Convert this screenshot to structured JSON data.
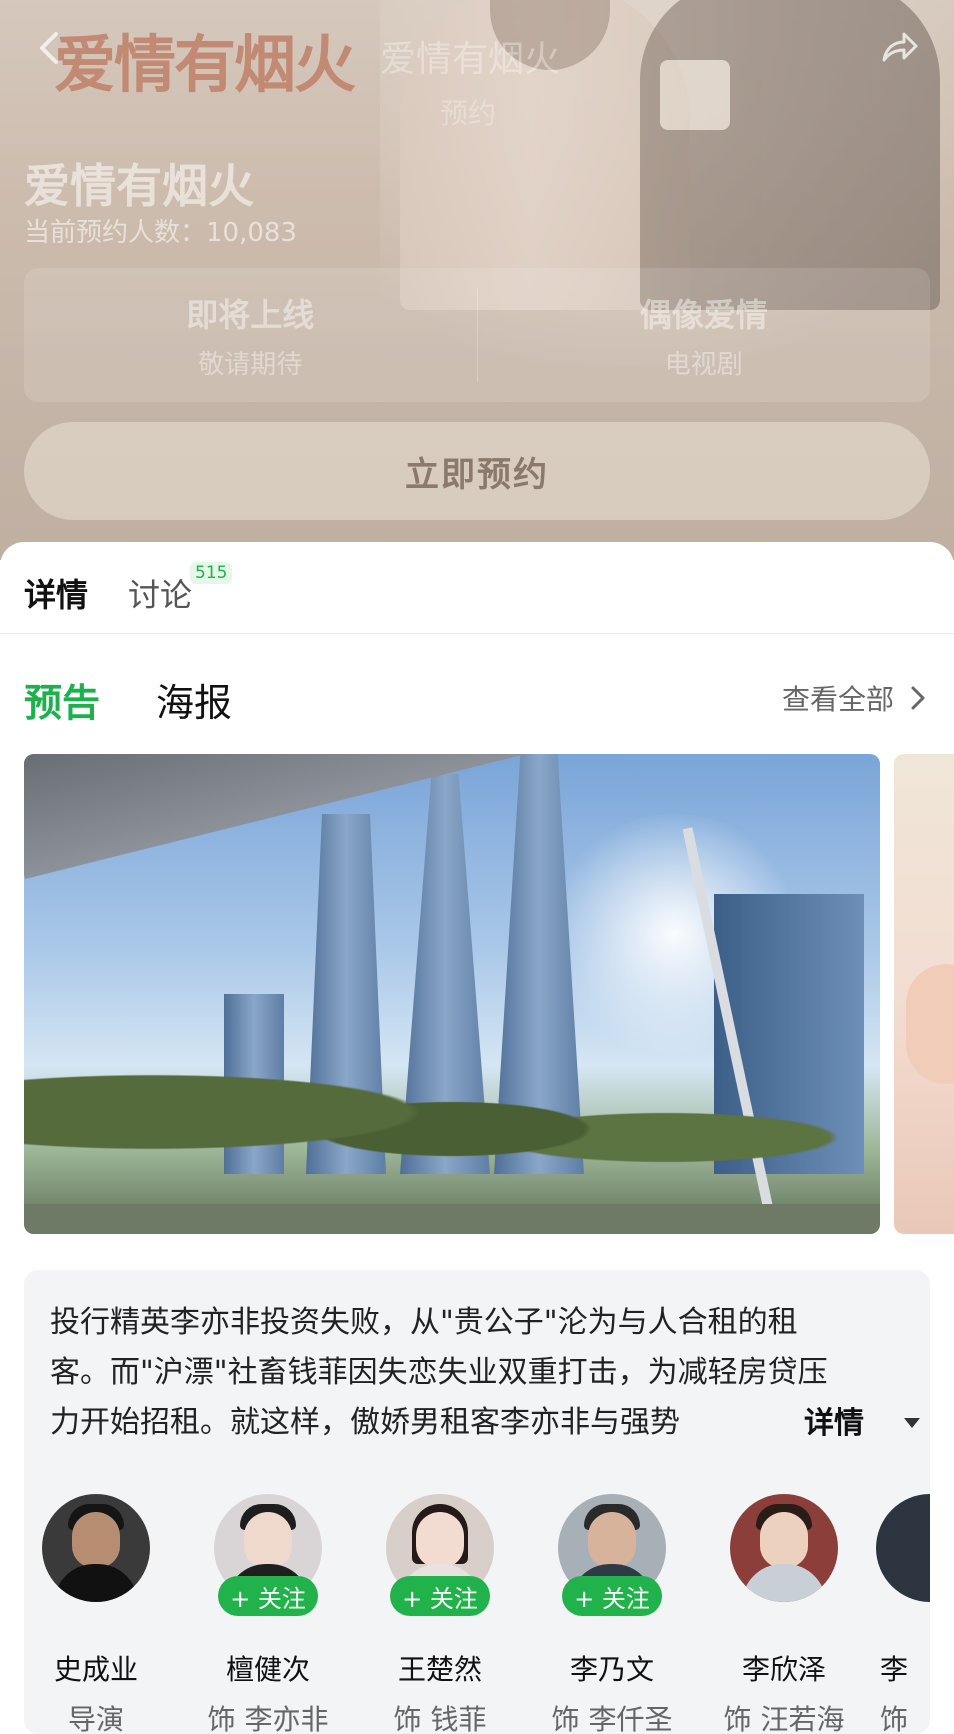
{
  "header": {
    "logo_text": "爱情有烟火",
    "ghost_title": "爱情有烟火",
    "ghost_subtitle": "预约",
    "title": "爱情有烟火",
    "reserve_count": "当前预约人数：10,083",
    "info": [
      {
        "main": "即将上线",
        "sub": "敬请期待"
      },
      {
        "main": "偶像爱情",
        "sub": "电视剧"
      }
    ],
    "reserve_button": "立即预约"
  },
  "tabs": {
    "detail": "详情",
    "discuss": "讨论",
    "discuss_badge": "515"
  },
  "media": {
    "trailer_tab": "预告",
    "poster_tab": "海报",
    "view_all": "查看全部"
  },
  "synopsis": {
    "text": "投行精英李亦非投资失败，从\"贵公子\"沦为与人合租的租客。而\"沪漂\"社畜钱菲因失恋失业双重打击，为减轻房贷压力开始招租。就这样，傲娇男租客李亦非与强势",
    "toggle": "详情"
  },
  "cast": [
    {
      "name": "史成业",
      "role": "导演",
      "follow": ""
    },
    {
      "name": "檀健次",
      "role": "饰 李亦非",
      "follow": "+ 关注"
    },
    {
      "name": "王楚然",
      "role": "饰 钱菲",
      "follow": "+ 关注"
    },
    {
      "name": "李乃文",
      "role": "饰 李仟圣",
      "follow": "+ 关注"
    },
    {
      "name": "李欣泽",
      "role": "饰 汪若海",
      "follow": ""
    },
    {
      "name": "李",
      "role": "饰",
      "follow": ""
    }
  ],
  "colors": {
    "accent_green": "#1db14e",
    "follow_green": "#22b24c",
    "logo": "#c07f68"
  },
  "icons": [
    "back-icon",
    "share-icon",
    "chevron-right-icon",
    "caret-down-icon"
  ]
}
